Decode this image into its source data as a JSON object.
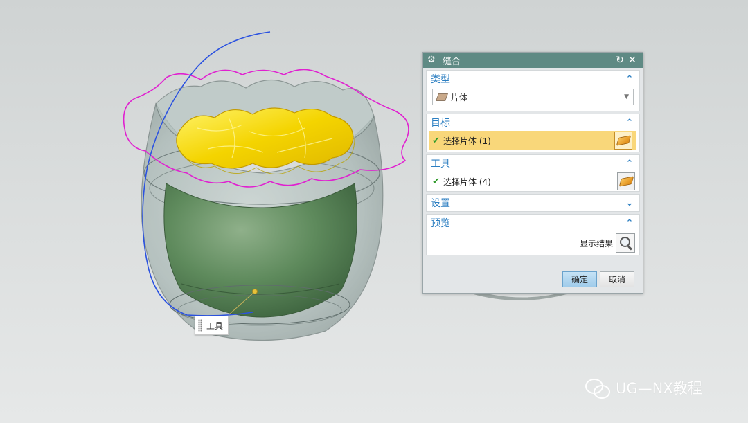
{
  "viewport": {
    "tool_label": "工具",
    "colors": {
      "background": "#d5d8d8",
      "curve_magenta": "#e020d0",
      "curve_blue": "#2b52e0",
      "sheet_yellow": "#f5e200",
      "body_green": "#4f7a4e"
    }
  },
  "dialog": {
    "title": "缝合",
    "icons": {
      "title": "gear-icon",
      "reset": "reset-icon",
      "close": "close-icon"
    },
    "sections": {
      "type": {
        "label": "类型",
        "chevron": "up",
        "select_value": "片体"
      },
      "target": {
        "label": "目标",
        "chevron": "up",
        "selection_text": "选择片体 (1)",
        "active": true
      },
      "tool": {
        "label": "工具",
        "chevron": "up",
        "selection_text": "选择片体 (4)"
      },
      "settings": {
        "label": "设置",
        "chevron": "down"
      },
      "preview": {
        "label": "预览",
        "chevron": "up",
        "show_result_label": "显示结果"
      }
    },
    "buttons": {
      "ok": "确定",
      "cancel": "取消"
    }
  },
  "watermark": {
    "text": "UG—NX教程"
  }
}
